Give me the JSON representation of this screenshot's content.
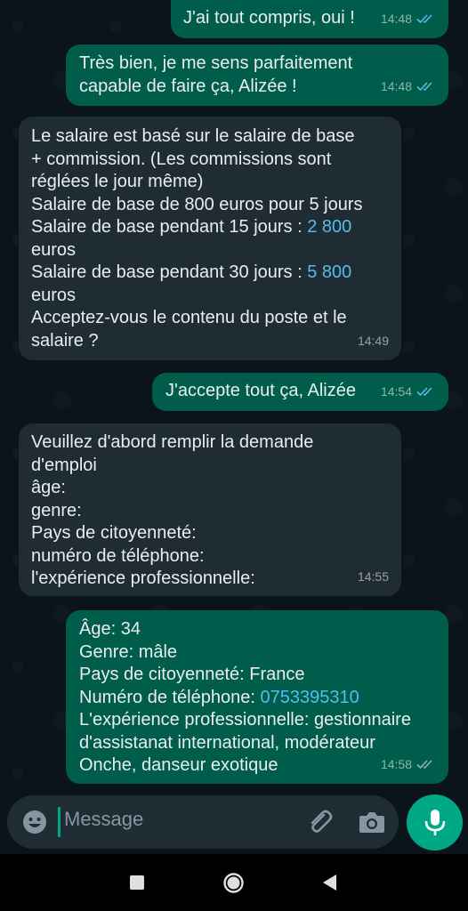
{
  "messages": [
    {
      "text": "J'ai tout compris, oui !",
      "time": "14:48"
    },
    {
      "text": "Très bien, je me sens parfaitement\ncapable de faire ça, Alizée !",
      "time": "14:48"
    },
    {
      "text_pre": "Le salaire est basé sur le salaire de base\n+ commission. (Les commissions sont\nréglées le jour même)\nSalaire de base de 800 euros pour 5 jours\nSalaire de base pendant 15 jours : ",
      "link1": "2 800",
      "text_mid": "\neuros\nSalaire de base pendant 30 jours : ",
      "link2": "5 800",
      "text_post": "\neuros\nAcceptez-vous le contenu du poste et le\nsalaire ?",
      "time": "14:49"
    },
    {
      "text": "J'accepte tout ça, Alizée",
      "time": "14:54"
    },
    {
      "text": "Veuillez d'abord remplir la demande\nd'emploi\nâge:\ngenre:\nPays de citoyenneté:\nnuméro de téléphone:\nl'expérience professionnelle:",
      "time": "14:55"
    },
    {
      "text_pre": "Âge: 34\nGenre: mâle\nPays de citoyenneté: France\nNuméro de téléphone: ",
      "phone": "0753395310",
      "text_post": "\nL'expérience professionnelle: gestionnaire\nd'assistanat international, modérateur\nOnche, danseur exotique",
      "time": "14:58"
    }
  ],
  "composer": {
    "placeholder": "Message"
  },
  "icons": {
    "emoji": "emoji-icon",
    "attach": "paperclip-icon",
    "camera": "camera-icon",
    "mic": "microphone-icon",
    "read_ticks": "double-check-blue",
    "delivered_ticks": "double-check-grey"
  },
  "colors": {
    "background": "#0b141a",
    "outgoing_bubble": "#005c4b",
    "incoming_bubble": "#202c33",
    "accent": "#00a884",
    "link": "#53bdeb"
  }
}
